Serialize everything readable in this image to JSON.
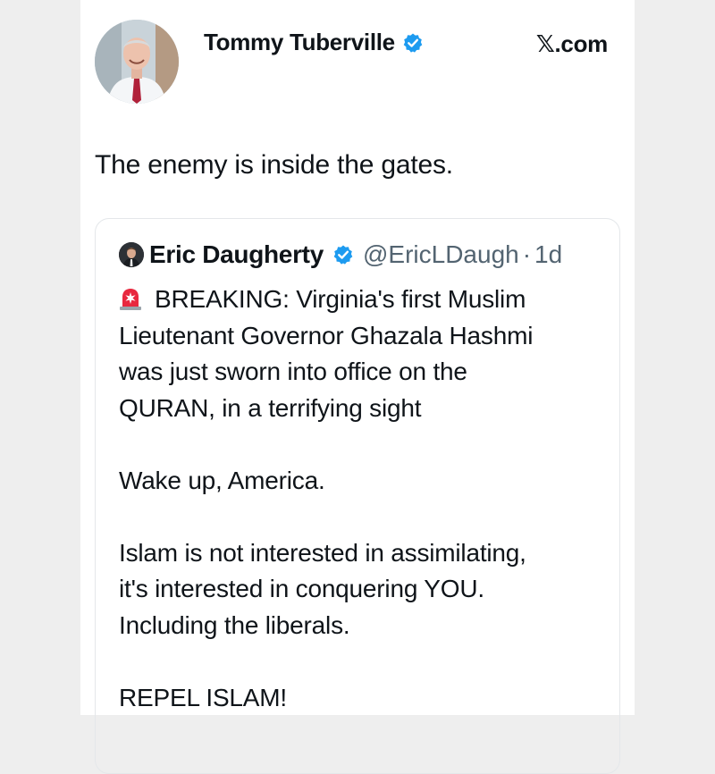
{
  "author": {
    "display_name": "Tommy Tuberville",
    "avatar_icon": "profile-photo",
    "verified_icon": "verified-badge-icon"
  },
  "site": {
    "label": "𝕏.com"
  },
  "tweet": {
    "text": "The enemy is inside the gates."
  },
  "quoted_tweet": {
    "display_name": "Eric Daugherty",
    "handle": "@EricLDaugh",
    "separator": "·",
    "time": "1d",
    "lines": {
      "line1": "BREAKING: Virginia's first Muslim",
      "line2": "Lieutenant Governor Ghazala Hashmi",
      "line3": "was just sworn into office on the",
      "line4": "QURAN, in a terrifying sight",
      "line5": "Wake up, America.",
      "line6": "Islam is not interested in assimilating,",
      "line7": "it's interested in conquering YOU.",
      "line8": "Including the liberals.",
      "line9": "REPEL ISLAM!"
    },
    "leading_icon": "rotating-light-siren-icon"
  },
  "colors": {
    "verified_blue": "#1d9bf0",
    "text": "#0f1419",
    "secondary_text": "#536471",
    "border": "#e4e7ea"
  }
}
